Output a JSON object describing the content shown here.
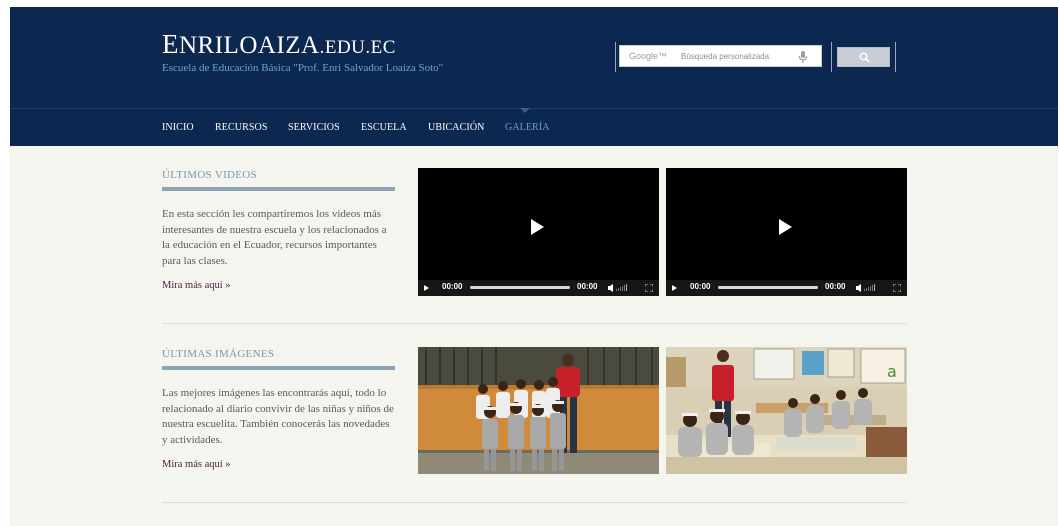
{
  "header": {
    "title_initial": "E",
    "title_main": "NRILOAIZA",
    "title_suffix": ".EDU.EC",
    "tagline": "Escuela de Educación Básica \"Prof. Enri Salvador Loaiza Soto\""
  },
  "search": {
    "brand": "Google™",
    "placeholder": "Búsqueda personalizada",
    "value": ""
  },
  "nav": {
    "items": [
      {
        "label": "INICIO"
      },
      {
        "label": "RECURSOS"
      },
      {
        "label": "SERVICIOS"
      },
      {
        "label": "ESCUELA"
      },
      {
        "label": "UBICACIÓN"
      },
      {
        "label": "GALERÍA",
        "active": true
      }
    ]
  },
  "videos_section": {
    "title": "ÚLTIMOS VIDEOS",
    "description": "En esta sección les compartiremos los videos más interesantes de nuestra escuela y los relacionados a la educación en el Ecuador, recursos importantes para las clases.",
    "more_link": "Mira más aquí »",
    "videos": [
      {
        "current_time": "00:00",
        "duration": "00:00"
      },
      {
        "current_time": "00:00",
        "duration": "00:00"
      }
    ]
  },
  "images_section": {
    "title": "ÚLTIMAS IMÁGENES",
    "description": "Las mejores imágenes las encontrarás aquí, todo lo relacionado al diario convivir de las niñas y niños de nuestra escuelita. También conocerás las novedades y actividades.",
    "more_link": "Mira más aquí »"
  },
  "colors": {
    "header_bg": "#0d2850",
    "nav_active": "#6d9cd0",
    "tagline": "#6fa0d2",
    "page_bg": "#f4f5ee",
    "section_rule": "#8ea3b5",
    "link": "#4b2240"
  }
}
